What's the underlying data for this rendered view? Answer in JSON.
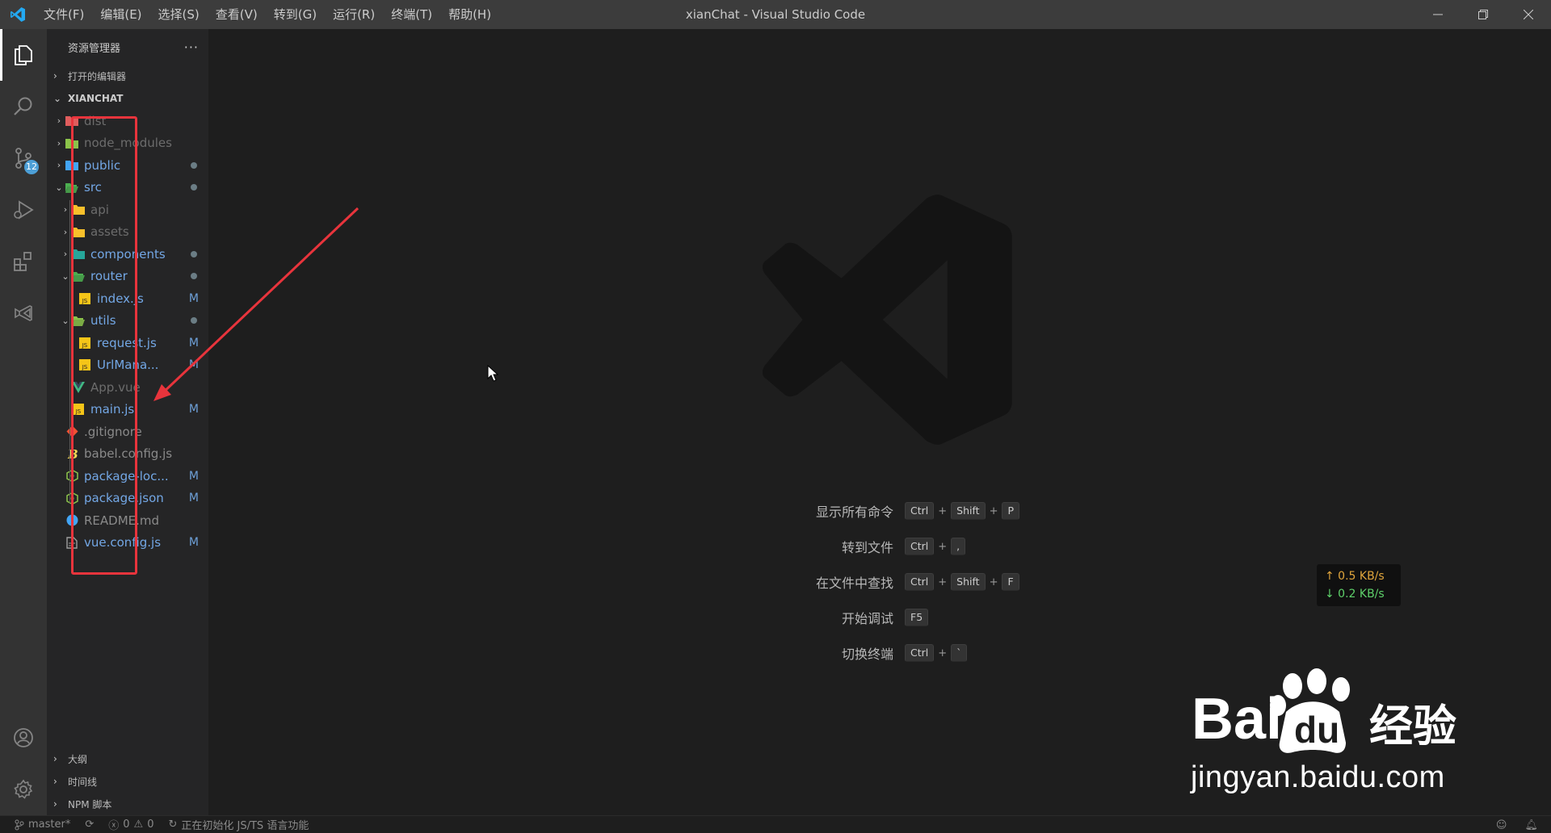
{
  "window": {
    "title": "xianChat - Visual Studio Code",
    "menu": [
      "文件(F)",
      "编辑(E)",
      "选择(S)",
      "查看(V)",
      "转到(G)",
      "运行(R)",
      "终端(T)",
      "帮助(H)"
    ]
  },
  "activity_bar": {
    "items": [
      "files-icon",
      "search-icon",
      "source-control-icon",
      "run-debug-icon",
      "extensions-icon",
      "remote-explorer-icon"
    ],
    "scm_badge": "12",
    "bottom": [
      "account-icon",
      "settings-gear-icon"
    ]
  },
  "sidebar": {
    "title": "资源管理器",
    "more": "···",
    "open_editors": "打开的编辑器",
    "project": "XIANCHAT",
    "tree": [
      {
        "name": "dist",
        "type": "folder",
        "color": "#e05d5d",
        "state": "ignored",
        "deco": ""
      },
      {
        "name": "node_modules",
        "type": "folder",
        "color": "#8bc34a",
        "state": "ignored",
        "deco": ""
      },
      {
        "name": "public",
        "type": "folder",
        "color": "#42a5f5",
        "state": "modified",
        "deco": "dot"
      },
      {
        "name": "src",
        "type": "folder-open",
        "color": "#4caf50",
        "state": "modified",
        "deco": "dot"
      },
      {
        "name": "api",
        "type": "folder",
        "color": "#f9c02b",
        "state": "ignored",
        "deco": ""
      },
      {
        "name": "assets",
        "type": "folder",
        "color": "#f9c02b",
        "state": "ignored",
        "deco": ""
      },
      {
        "name": "components",
        "type": "folder",
        "color": "#26a69a",
        "state": "modified",
        "deco": "dot"
      },
      {
        "name": "router",
        "type": "folder-open",
        "color": "#4caf50",
        "state": "modified",
        "deco": "dot"
      },
      {
        "name": "index.js",
        "type": "js",
        "color": "#f5c518",
        "state": "modified",
        "deco": "M"
      },
      {
        "name": "utils",
        "type": "folder-open",
        "color": "#8bc34a",
        "state": "modified",
        "deco": "dot"
      },
      {
        "name": "request.js",
        "type": "js",
        "color": "#f5c518",
        "state": "modified",
        "deco": "M"
      },
      {
        "name": "UrlMana...",
        "type": "js",
        "color": "#f5c518",
        "state": "modified",
        "deco": "M"
      },
      {
        "name": "App.vue",
        "type": "vue",
        "color": "#41b883",
        "state": "ignored",
        "deco": ""
      },
      {
        "name": "main.js",
        "type": "js",
        "color": "#f5c518",
        "state": "modified",
        "deco": "M"
      },
      {
        "name": ".gitignore",
        "type": "git",
        "color": "#f05133",
        "state": "ignored",
        "deco": ""
      },
      {
        "name": "babel.config.js",
        "type": "babel",
        "color": "#f5da55",
        "state": "ignored",
        "deco": ""
      },
      {
        "name": "package-loc...",
        "type": "npm",
        "color": "#8bc34a",
        "state": "modified",
        "deco": "M"
      },
      {
        "name": "package.json",
        "type": "npm",
        "color": "#8bc34a",
        "state": "modified",
        "deco": "M"
      },
      {
        "name": "README.md",
        "type": "info",
        "color": "#42a5f5",
        "state": "ignored",
        "deco": ""
      },
      {
        "name": "vue.config.js",
        "type": "config",
        "color": "#9e9e9e",
        "state": "modified",
        "deco": "M"
      }
    ],
    "bottom_sections": [
      "大纲",
      "时间线",
      "NPM 脚本"
    ]
  },
  "editor": {
    "shortcuts": [
      {
        "label": "显示所有命令",
        "keys": [
          "Ctrl",
          "Shift",
          "P"
        ]
      },
      {
        "label": "转到文件",
        "keys": [
          "Ctrl",
          ","
        ]
      },
      {
        "label": "在文件中查找",
        "keys": [
          "Ctrl",
          "Shift",
          "F"
        ]
      },
      {
        "label": "开始调试",
        "keys": [
          "F5"
        ]
      },
      {
        "label": "切换终端",
        "keys": [
          "Ctrl",
          "`"
        ]
      }
    ]
  },
  "net_speed": {
    "up": "↑ 0.5 KB/s",
    "down": "↓ 0.2 KB/s"
  },
  "watermark": {
    "brand": "Bai du 经验",
    "url": "jingyan.baidu.com"
  },
  "statusbar": {
    "branch": "master*",
    "errors": "0",
    "warnings": "0",
    "message": "正在初始化 JS/TS 语言功能"
  }
}
